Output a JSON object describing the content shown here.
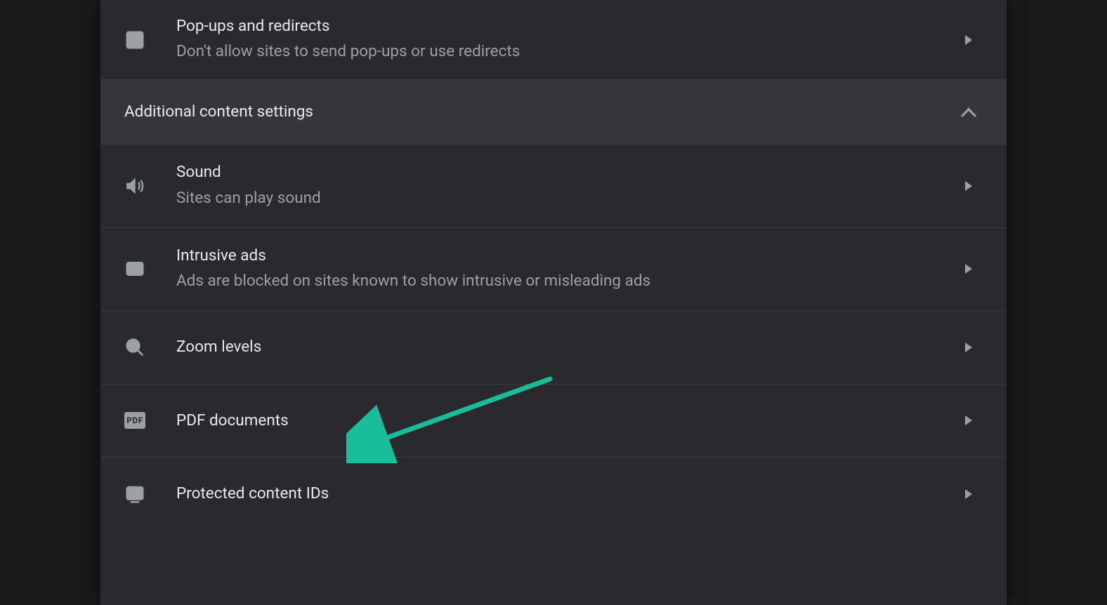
{
  "rows": {
    "popups": {
      "title": "Pop-ups and redirects",
      "subtitle": "Don't allow sites to send pop-ups or use redirects"
    },
    "section": {
      "title": "Additional content settings"
    },
    "sound": {
      "title": "Sound",
      "subtitle": "Sites can play sound"
    },
    "ads": {
      "title": "Intrusive ads",
      "subtitle": "Ads are blocked on sites known to show intrusive or misleading ads"
    },
    "zoom": {
      "title": "Zoom levels"
    },
    "pdf": {
      "title": "PDF documents",
      "badge": "PDF"
    },
    "protected": {
      "title": "Protected content IDs"
    }
  },
  "colors": {
    "accent_arrow": "#1abc9c"
  }
}
